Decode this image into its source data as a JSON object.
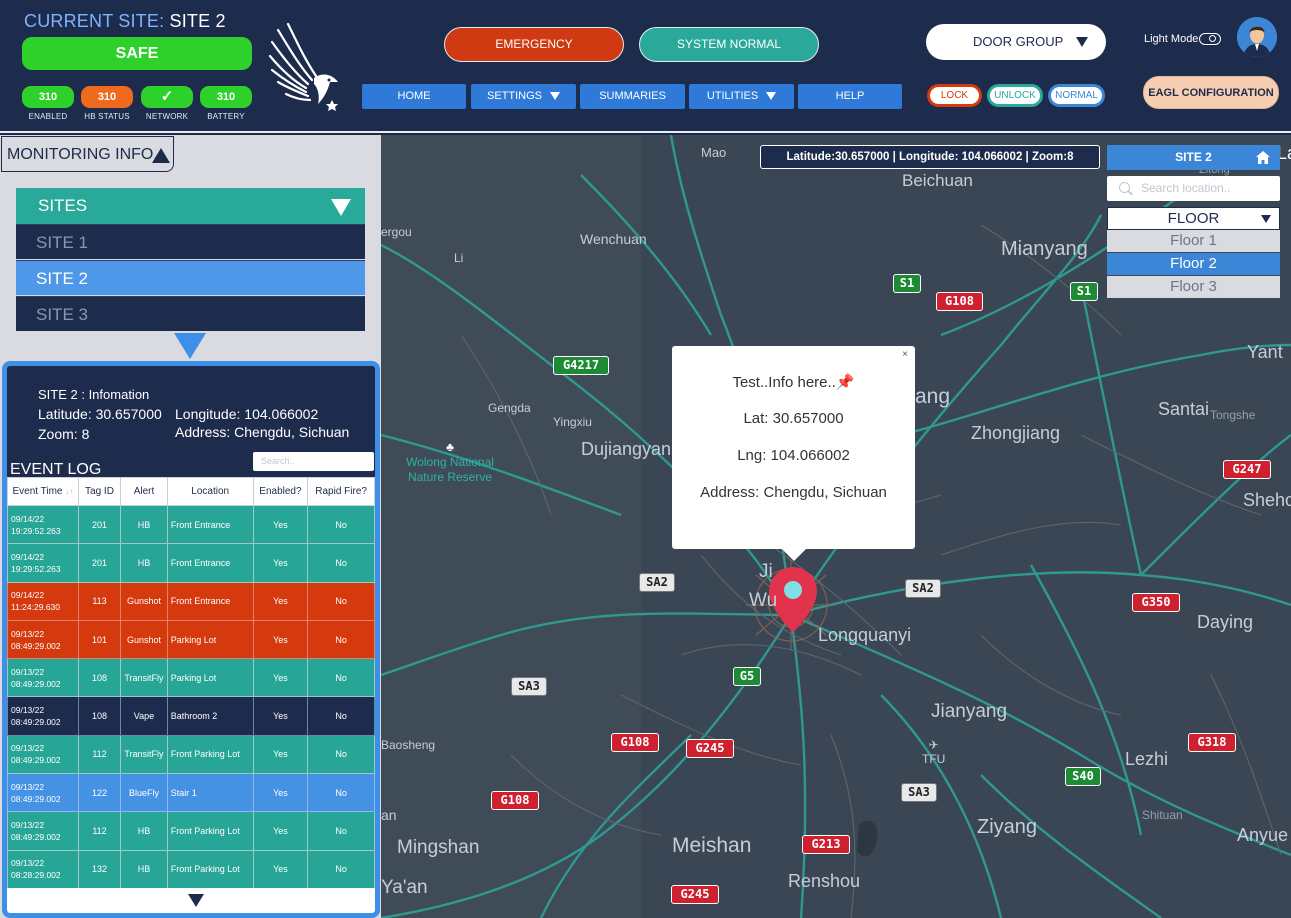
{
  "header": {
    "current_site_label": "CURRENT SITE:",
    "current_site_value": "SITE 2",
    "safe_label": "SAFE",
    "stats": [
      {
        "value": "310",
        "label": "ENABLED",
        "color": "#2ed12a"
      },
      {
        "value": "310",
        "label": "HB STATUS",
        "color": "#f06a1e"
      },
      {
        "value": "✓",
        "label": "NETWORK",
        "color": "#2ed12a"
      },
      {
        "value": "310",
        "label": "BATTERY",
        "color": "#2ed12a"
      }
    ],
    "emergency_label": "EMERGENCY",
    "system_normal_label": "SYSTEM NORMAL",
    "nav": {
      "home": "HOME",
      "settings": "SETTINGS",
      "summaries": "SUMMARIES",
      "utilities": "UTILITIES",
      "help": "HELP"
    },
    "door_group_label": "DOOR GROUP",
    "lock_label": "LOCK",
    "unlock_label": "UNLOCK",
    "normal_label": "NORMAL",
    "light_mode_label": "Light Mode",
    "eagl_config_label": "EAGL CONFIGURATION",
    "colors": {
      "emergency": "#cf3a12",
      "system_normal": "#2aa99a",
      "nav": "#2f7ad8"
    }
  },
  "left": {
    "monitoring_label": "MONITORING INFO.",
    "sites_header": "SITES",
    "sites": [
      "SITE 1",
      "SITE 2",
      "SITE 3"
    ],
    "selected_site": "SITE 2",
    "info": {
      "title": "SITE 2 : Infomation",
      "latitude": "Latitude: 30.657000",
      "longitude": "Longitude: 104.066002",
      "zoom": "Zoom: 8",
      "address": "Address: Chengdu, Sichuan"
    },
    "event_log": {
      "title": "EVENT LOG",
      "search_placeholder": "Search..",
      "columns": [
        "Event Time",
        "Tag ID",
        "Alert",
        "Location",
        "Enabled?",
        "Rapid Fire?"
      ],
      "rows": [
        {
          "time": "09/14/22 19:29:52.263",
          "tag": "201",
          "alert": "HB",
          "location": "Front Entrance",
          "enabled": "Yes",
          "rapid": "No",
          "style": "teal"
        },
        {
          "time": "09/14/22 19:29:52.263",
          "tag": "201",
          "alert": "HB",
          "location": "Front Entrance",
          "enabled": "Yes",
          "rapid": "No",
          "style": "teal"
        },
        {
          "time": "09/14/22 11:24:29.630",
          "tag": "113",
          "alert": "Gunshot",
          "location": "Front Entrance",
          "enabled": "Yes",
          "rapid": "No",
          "style": "red"
        },
        {
          "time": "09/13/22 08:49:29.002",
          "tag": "101",
          "alert": "Gunshot",
          "location": "Parking Lot",
          "enabled": "Yes",
          "rapid": "No",
          "style": "red"
        },
        {
          "time": "09/13/22 08:49:29.002",
          "tag": "108",
          "alert": "TransitFly",
          "location": "Parking Lot",
          "enabled": "Yes",
          "rapid": "No",
          "style": "teal"
        },
        {
          "time": "09/13/22 08:49:29.002",
          "tag": "108",
          "alert": "Vape",
          "location": "Bathroom 2",
          "enabled": "Yes",
          "rapid": "No",
          "style": "navy"
        },
        {
          "time": "09/13/22 08:49:29.002",
          "tag": "112",
          "alert": "TransitFly",
          "location": "Front Parking Lot",
          "enabled": "Yes",
          "rapid": "No",
          "style": "teal"
        },
        {
          "time": "09/13/22 08:49:29.002",
          "tag": "122",
          "alert": "BlueFly",
          "location": "Stair 1",
          "enabled": "Yes",
          "rapid": "No",
          "style": "blue"
        },
        {
          "time": "09/13/22 08:49:29.002",
          "tag": "112",
          "alert": "HB",
          "location": "Front Parking Lot",
          "enabled": "Yes",
          "rapid": "No",
          "style": "teal"
        },
        {
          "time": "09/13/22 08:28:29.002",
          "tag": "132",
          "alert": "HB",
          "location": "Front Parking Lot",
          "enabled": "Yes",
          "rapid": "No",
          "style": "teal"
        }
      ]
    }
  },
  "map": {
    "coord_text": "Latitude:30.657000 | Longitude: 104.066002 | Zoom:8",
    "site_header": "SITE 2",
    "search_placeholder": "Search location..",
    "floor_label": "FLOOR",
    "floors": [
      "Floor 1",
      "Floor 2",
      "Floor 3"
    ],
    "selected_floor": "Floor 2",
    "popup": {
      "close": "×",
      "title": "Test..Info here..",
      "lat": "Lat: 30.657000",
      "lng": "Lng: 104.066002",
      "address": "Address: Chengdu, Sichuan"
    },
    "places": {
      "mao": "Mao",
      "beichuan": "Beichuan",
      "wenchuan": "Wenchuan",
      "ergou": "ergou",
      "li": "Li",
      "mianyang": "Mianyang",
      "gengda": "Gengda",
      "yingxiu": "Yingxiu",
      "dujiangyan": "Dujiangyan",
      "wolong": "Wolong National Nature Reserve",
      "santai": "Santai",
      "tongshe": "Tongshe",
      "zhongjiang": "Zhongjiang",
      "yant": "Yant",
      "shehe": "Sheho",
      "ang": "ang",
      "longquanyi": "Longquanyi",
      "daying": "Daying",
      "jianyang": "Jianyang",
      "baosheng": "Baosheng",
      "tfu": "TFU",
      "lezhi": "Lezhi",
      "shituan": "Shituan",
      "ziyang": "Ziyang",
      "anyue": "Anyue",
      "mingshan": "Mingshan",
      "meishan": "Meishan",
      "renshou": "Renshou",
      "yaan": "Ya'an",
      "an": "an",
      "ji": "Ji",
      "wu": "Wu",
      "zitong": "Zitong",
      "la": "La"
    },
    "shields": {
      "s1a": "S1",
      "g108a": "G108",
      "s1b": "S1",
      "g4217": "G4217",
      "g247": "G247",
      "sa2a": "SA2",
      "sa2b": "SA2",
      "g350": "G350",
      "sa3a": "SA3",
      "g5": "G5",
      "g108b": "G108",
      "g245a": "G245",
      "g318": "G318",
      "s40": "S40",
      "sa3b": "SA3",
      "g108c": "G108",
      "g213": "G213",
      "g245b": "G245"
    },
    "colors": {
      "road": "#2f9d94",
      "land": "#3b4755",
      "marker": "#e2334c"
    }
  }
}
